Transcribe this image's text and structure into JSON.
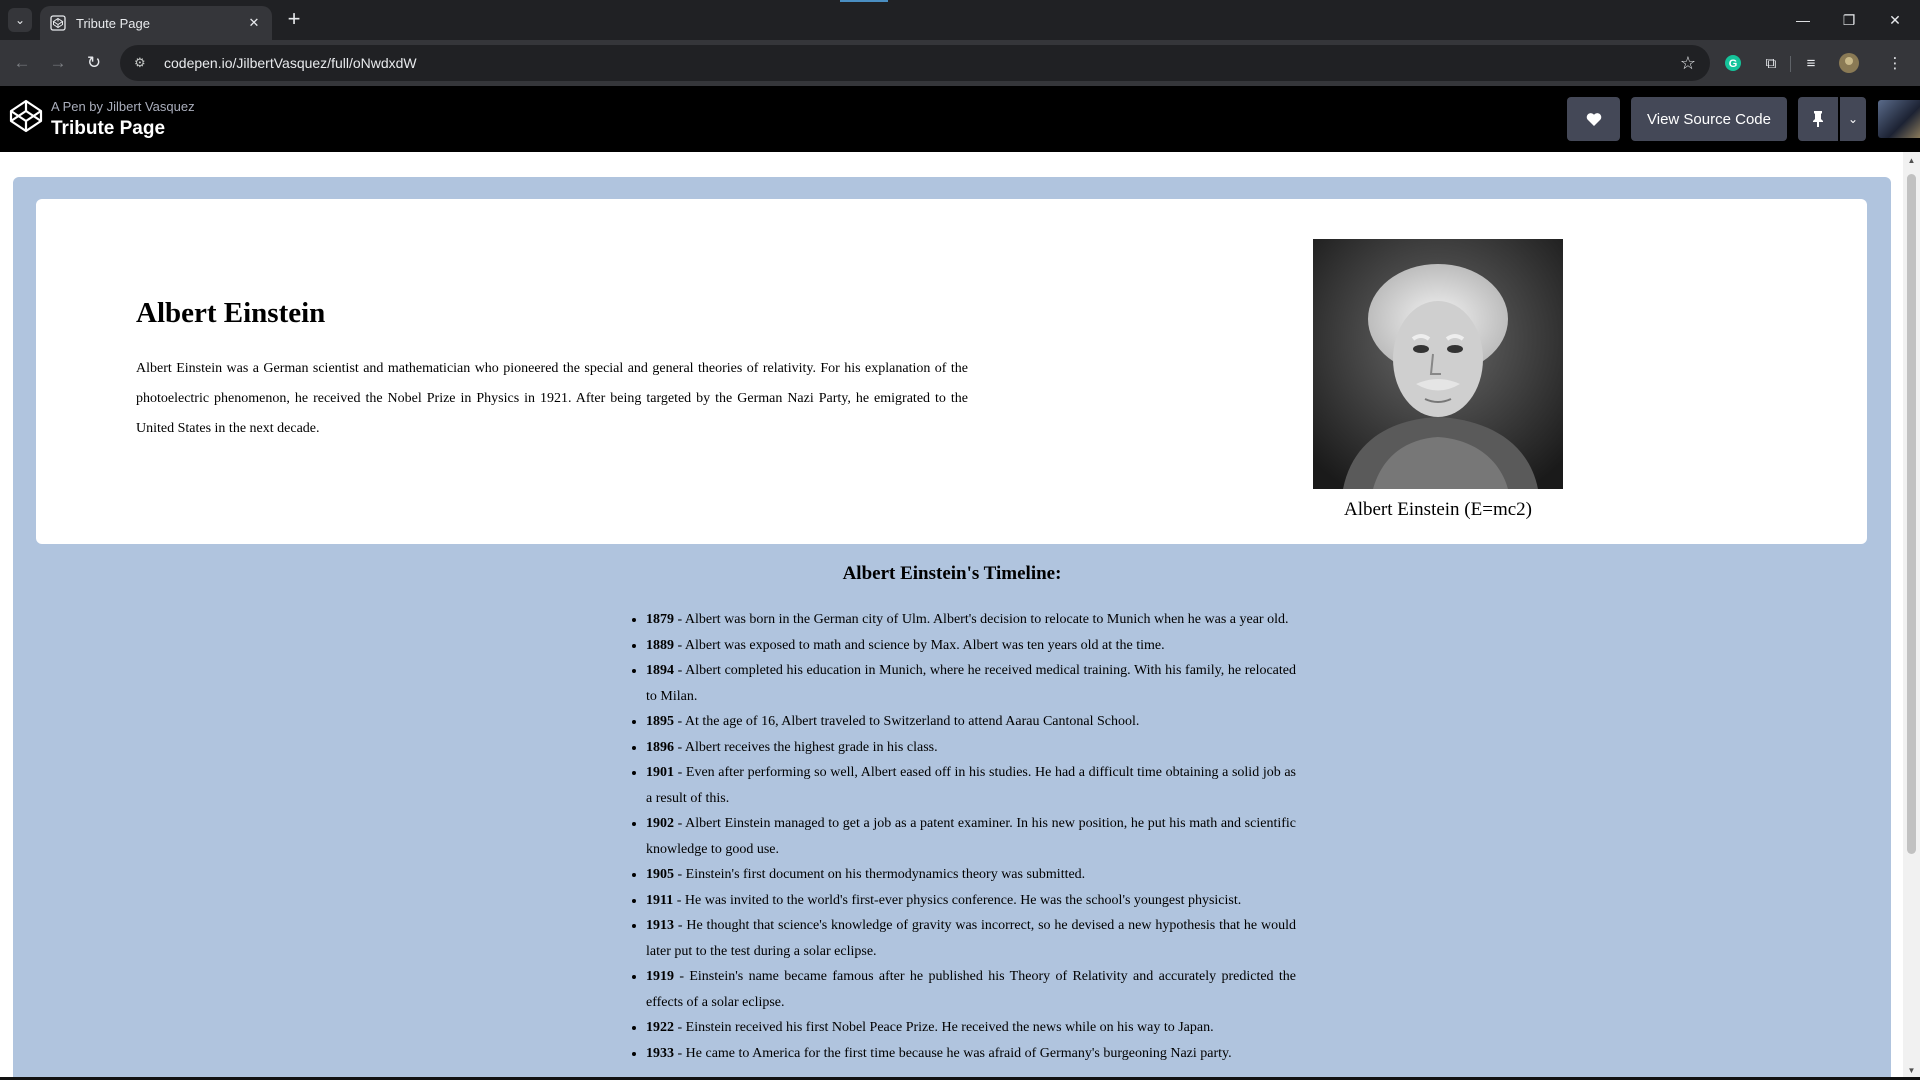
{
  "browser": {
    "tab_title": "Tribute Page",
    "url": "codepen.io/JilbertVasquez/full/oNwdxdW",
    "new_tab_label": "+",
    "close_tab_label": "✕"
  },
  "codepen": {
    "by_line": "A Pen by Jilbert Vasquez",
    "pen_title": "Tribute Page",
    "view_source_label": "View Source Code",
    "icons": [
      "heart-icon",
      "pin-icon",
      "chevron-down-icon"
    ]
  },
  "intro": {
    "heading": "Albert Einstein",
    "paragraph": "Albert Einstein was a German scientist and mathematician who pioneered the special and general theories of relativity. For his explanation of the photoelectric phenomenon, he received the Nobel Prize in Physics in 1921. After being targeted by the German Nazi Party, he emigrated to the United States in the next decade.",
    "caption": "Albert Einstein (E=mc2)"
  },
  "timeline": {
    "title": "Albert Einstein's Timeline:",
    "items": [
      {
        "year": "1879",
        "text": " - Albert was born in the German city of Ulm. Albert's decision to relocate to Munich when he was a year old."
      },
      {
        "year": "1889",
        "text": " - Albert was exposed to math and science by Max. Albert was ten years old at the time."
      },
      {
        "year": "1894",
        "text": " - Albert completed his education in Munich, where he received medical training. With his family, he relocated to Milan."
      },
      {
        "year": "1895",
        "text": " - At the age of 16, Albert traveled to Switzerland to attend Aarau Cantonal School."
      },
      {
        "year": "1896",
        "text": " - Albert receives the highest grade in his class."
      },
      {
        "year": "1901",
        "text": " - Even after performing so well, Albert eased off in his studies. He had a difficult time obtaining a solid job as a result of this."
      },
      {
        "year": "1902",
        "text": " - Albert Einstein managed to get a job as a patent examiner. In his new position, he put his math and scientific knowledge to good use."
      },
      {
        "year": "1905",
        "text": " - Einstein's first document on his thermodynamics theory was submitted."
      },
      {
        "year": "1911",
        "text": " - He was invited to the world's first-ever physics conference. He was the school's youngest physicist."
      },
      {
        "year": "1913",
        "text": " - He thought that science's knowledge of gravity was incorrect, so he devised a new hypothesis that he would later put to the test during a solar eclipse."
      },
      {
        "year": "1919",
        "text": " - Einstein's name became famous after he published his Theory of Relativity and accurately predicted the effects of a solar eclipse."
      },
      {
        "year": "1922",
        "text": " - Einstein received his first Nobel Peace Prize. He received the news while on his way to Japan."
      },
      {
        "year": "1933",
        "text": " - He came to America for the first time because he was afraid of Germany's burgeoning Nazi party."
      }
    ]
  }
}
